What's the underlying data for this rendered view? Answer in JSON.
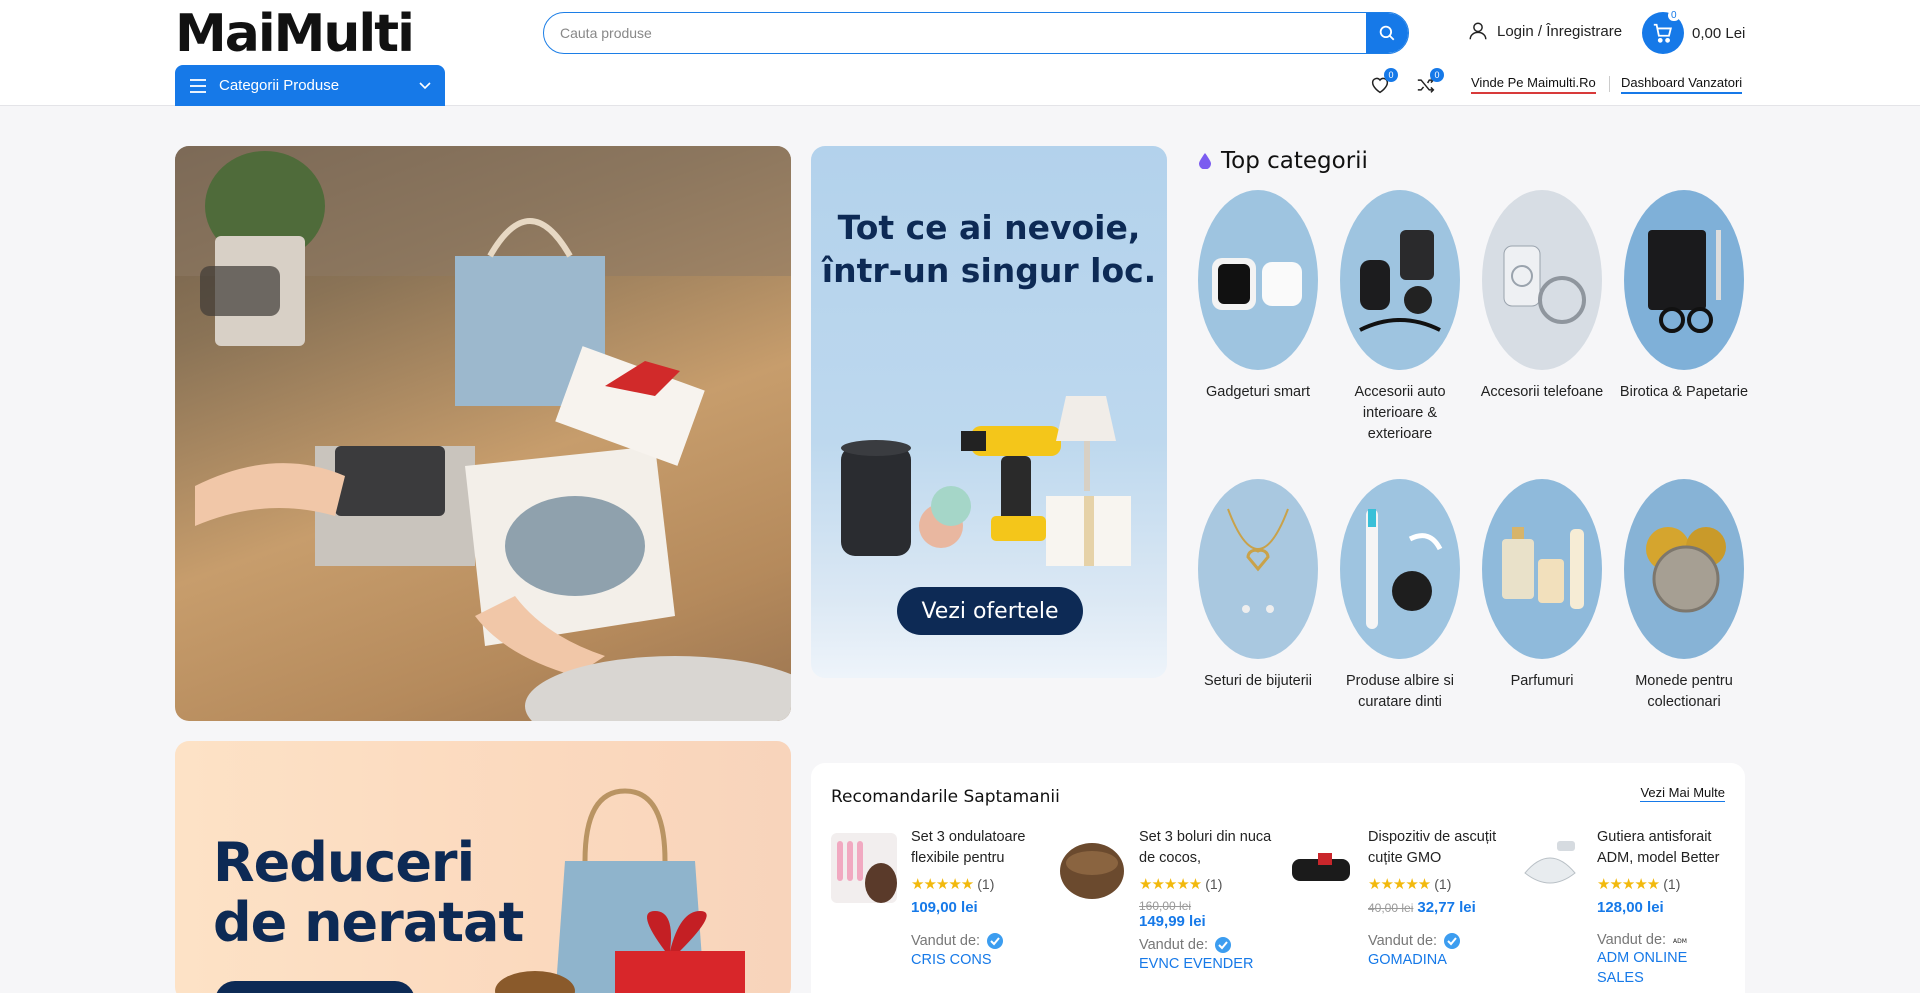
{
  "header": {
    "logo": "MaiMulti",
    "search_placeholder": "Cauta produse",
    "login": "Login / Înregistrare",
    "cart_count": "0",
    "cart_total": "0,00 Lei",
    "categories_btn": "Categorii Produse",
    "wishlist_count": "0",
    "compare_count": "0",
    "link_sell": "Vinde Pe Maimulti.Ro",
    "link_dashboard": "Dashboard Vanzatori",
    "accent": "#1679e8"
  },
  "promo": {
    "title_line1": "Tot ce ai nevoie,",
    "title_line2": "într-un singur loc.",
    "button": "Vezi ofertele"
  },
  "top_categories": {
    "title": "Top categorii",
    "items": [
      {
        "label": "Gadgeturi smart"
      },
      {
        "label": "Accesorii auto interioare & exterioare"
      },
      {
        "label": "Accesorii telefoane"
      },
      {
        "label": "Birotica & Papetarie"
      },
      {
        "label": "Seturi de bijuterii"
      },
      {
        "label": "Produse albire si curatare dinti"
      },
      {
        "label": "Parfumuri"
      },
      {
        "label": "Monede pentru colectionari"
      }
    ]
  },
  "reduceri": {
    "line1": "Reduceri",
    "line2": "de neratat"
  },
  "recommendations": {
    "title": "Recomandarile Saptamanii",
    "more": "Vezi Mai Multe",
    "seller_label": "Vandut de:",
    "products": [
      {
        "name": "Set 3 ondulatoare flexibile pentru",
        "reviews": "(1)",
        "old_price": "",
        "price": "109,00 lei",
        "seller": "CRIS CONS"
      },
      {
        "name": "Set 3 boluri din nuca de cocos,",
        "reviews": "(1)",
        "old_price": "160,00 lei",
        "price": "149,99 lei",
        "seller": "EVNC EVENDER"
      },
      {
        "name": "Dispozitiv de ascuțit cuțite GMO",
        "reviews": "(1)",
        "old_price": "40,00 lei",
        "price": "32,77 lei",
        "seller": "GOMADINA"
      },
      {
        "name": "Gutiera antisforait ADM, model Better",
        "reviews": "(1)",
        "old_price": "",
        "price": "128,00 lei",
        "seller": "ADM ONLINE SALES"
      }
    ]
  }
}
